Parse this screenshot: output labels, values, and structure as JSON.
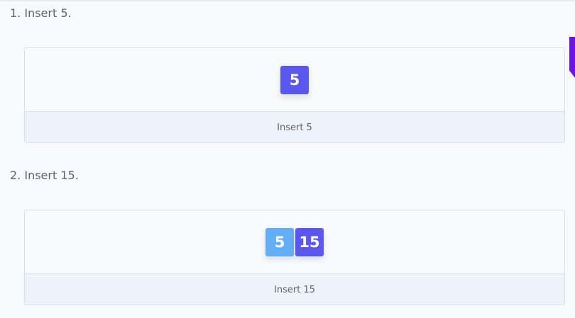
{
  "steps": [
    {
      "title": "1. Insert 5.",
      "caption": "Insert 5",
      "nodes": [
        {
          "value": "5",
          "state": "new"
        }
      ]
    },
    {
      "title": "2. Insert 15.",
      "caption": "Insert 15",
      "nodes": [
        {
          "value": "5",
          "state": "existing"
        },
        {
          "value": "15",
          "state": "new"
        }
      ]
    }
  ],
  "colors": {
    "new_node": "#5a57ee",
    "existing_node": "#64aef7",
    "side_tab": "#6a15d8"
  }
}
